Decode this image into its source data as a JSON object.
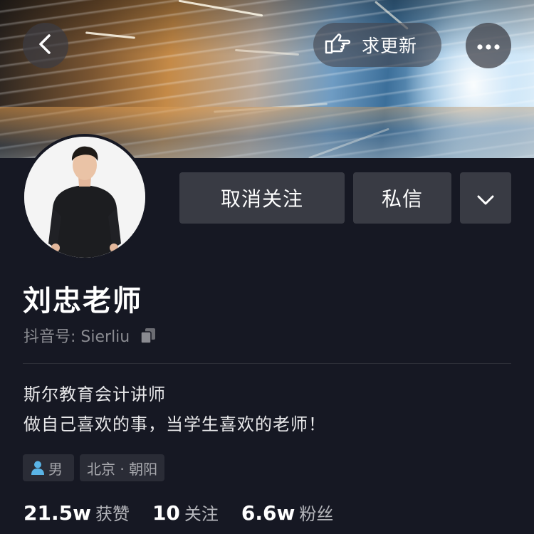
{
  "header": {
    "back_icon": "chevron-left-icon",
    "request_update_label": "求更新",
    "request_update_icon": "pointing-hand-icon",
    "more_icon": "more-dots-icon"
  },
  "actions": {
    "unfollow_label": "取消关注",
    "message_label": "私信",
    "expand_icon": "chevron-down-icon"
  },
  "profile": {
    "name": "刘忠老师",
    "douyin_id": "抖音号: Sierliu",
    "copy_icon": "copy-icon",
    "bio_line1": "斯尔教育会计讲师",
    "bio_line2": "做自己喜欢的事，当学生喜欢的老师！"
  },
  "tags": {
    "gender": "男",
    "gender_icon": "person-icon",
    "location": "北京 · 朝阳"
  },
  "stats": {
    "likes_value": "21.5w",
    "likes_label": "获赞",
    "following_value": "10",
    "following_label": "关注",
    "followers_value": "6.6w",
    "followers_label": "粉丝"
  },
  "colors": {
    "background": "#161823",
    "button": "#393b44",
    "secondary_text": "#8a8b91",
    "gender_icon": "#5ab4e6"
  }
}
